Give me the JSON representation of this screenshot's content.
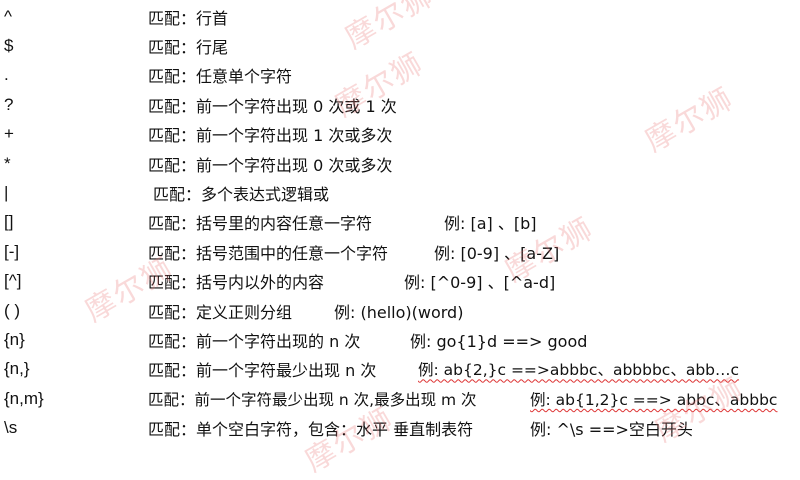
{
  "rows": [
    {
      "sym": "^",
      "desc": "匹配：行首",
      "ex": ""
    },
    {
      "sym": "$",
      "desc": "匹配：行尾",
      "ex": ""
    },
    {
      "sym": ".",
      "desc": "匹配：任意单个字符",
      "ex": ""
    },
    {
      "sym": "?",
      "desc": "匹配：前一个字符出现 0 次或 1 次",
      "ex": ""
    },
    {
      "sym": "+",
      "desc": "匹配：前一个字符出现 1 次或多次",
      "ex": ""
    },
    {
      "sym": "*",
      "desc": "匹配：前一个字符出现 0 次或多次",
      "ex": ""
    },
    {
      "sym": "|",
      "desc": "匹配：多个表达式逻辑或",
      "ex": ""
    },
    {
      "sym": "[]",
      "desc": "匹配：括号里的内容任意一字符",
      "ex": "例: [a] 、[b]"
    },
    {
      "sym": "[-]",
      "desc": "匹配：括号范围中的任意一个字符",
      "ex": "例: [0-9] 、[a-Z]"
    },
    {
      "sym": "[^]",
      "desc": "匹配：括号内以外的内容",
      "ex": "例: [^0-9] 、[^a-d]"
    },
    {
      "sym": "( )",
      "desc": "匹配：定义正则分组",
      "ex": "例: (hello)(word)"
    },
    {
      "sym": "{n}",
      "desc": "匹配：前一个字符出现的 n 次",
      "ex": "例: go{1}d ==> good"
    },
    {
      "sym": "{n,}",
      "desc": "匹配：前一个字符最少出现 n 次",
      "ex": "例:  ab{2,}c ==>abbbc、abbbbc、abb…c"
    },
    {
      "sym": "{n,m}",
      "desc": "匹配：前一个字符最少出现 n 次,最多出现 m 次",
      "ex": "例: ab{1,2}c ==> abbc、abbbc"
    },
    {
      "sym": "\\s",
      "desc": "匹配：单个空白字符，包含：水平 垂直制表符",
      "ex": "例: ^\\s  ==>空白开头"
    }
  ],
  "watermark": "摩尔狮"
}
